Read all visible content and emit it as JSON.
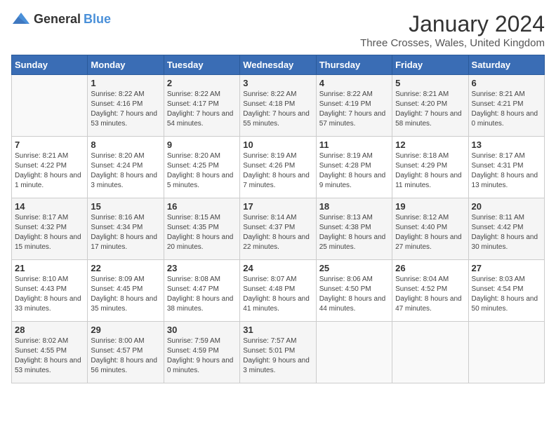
{
  "header": {
    "logo_general": "General",
    "logo_blue": "Blue",
    "title": "January 2024",
    "location": "Three Crosses, Wales, United Kingdom"
  },
  "weekdays": [
    "Sunday",
    "Monday",
    "Tuesday",
    "Wednesday",
    "Thursday",
    "Friday",
    "Saturday"
  ],
  "weeks": [
    [
      {
        "day": "",
        "sunrise": "",
        "sunset": "",
        "daylight": ""
      },
      {
        "day": "1",
        "sunrise": "Sunrise: 8:22 AM",
        "sunset": "Sunset: 4:16 PM",
        "daylight": "Daylight: 7 hours and 53 minutes."
      },
      {
        "day": "2",
        "sunrise": "Sunrise: 8:22 AM",
        "sunset": "Sunset: 4:17 PM",
        "daylight": "Daylight: 7 hours and 54 minutes."
      },
      {
        "day": "3",
        "sunrise": "Sunrise: 8:22 AM",
        "sunset": "Sunset: 4:18 PM",
        "daylight": "Daylight: 7 hours and 55 minutes."
      },
      {
        "day": "4",
        "sunrise": "Sunrise: 8:22 AM",
        "sunset": "Sunset: 4:19 PM",
        "daylight": "Daylight: 7 hours and 57 minutes."
      },
      {
        "day": "5",
        "sunrise": "Sunrise: 8:21 AM",
        "sunset": "Sunset: 4:20 PM",
        "daylight": "Daylight: 7 hours and 58 minutes."
      },
      {
        "day": "6",
        "sunrise": "Sunrise: 8:21 AM",
        "sunset": "Sunset: 4:21 PM",
        "daylight": "Daylight: 8 hours and 0 minutes."
      }
    ],
    [
      {
        "day": "7",
        "sunrise": "Sunrise: 8:21 AM",
        "sunset": "Sunset: 4:22 PM",
        "daylight": "Daylight: 8 hours and 1 minute."
      },
      {
        "day": "8",
        "sunrise": "Sunrise: 8:20 AM",
        "sunset": "Sunset: 4:24 PM",
        "daylight": "Daylight: 8 hours and 3 minutes."
      },
      {
        "day": "9",
        "sunrise": "Sunrise: 8:20 AM",
        "sunset": "Sunset: 4:25 PM",
        "daylight": "Daylight: 8 hours and 5 minutes."
      },
      {
        "day": "10",
        "sunrise": "Sunrise: 8:19 AM",
        "sunset": "Sunset: 4:26 PM",
        "daylight": "Daylight: 8 hours and 7 minutes."
      },
      {
        "day": "11",
        "sunrise": "Sunrise: 8:19 AM",
        "sunset": "Sunset: 4:28 PM",
        "daylight": "Daylight: 8 hours and 9 minutes."
      },
      {
        "day": "12",
        "sunrise": "Sunrise: 8:18 AM",
        "sunset": "Sunset: 4:29 PM",
        "daylight": "Daylight: 8 hours and 11 minutes."
      },
      {
        "day": "13",
        "sunrise": "Sunrise: 8:17 AM",
        "sunset": "Sunset: 4:31 PM",
        "daylight": "Daylight: 8 hours and 13 minutes."
      }
    ],
    [
      {
        "day": "14",
        "sunrise": "Sunrise: 8:17 AM",
        "sunset": "Sunset: 4:32 PM",
        "daylight": "Daylight: 8 hours and 15 minutes."
      },
      {
        "day": "15",
        "sunrise": "Sunrise: 8:16 AM",
        "sunset": "Sunset: 4:34 PM",
        "daylight": "Daylight: 8 hours and 17 minutes."
      },
      {
        "day": "16",
        "sunrise": "Sunrise: 8:15 AM",
        "sunset": "Sunset: 4:35 PM",
        "daylight": "Daylight: 8 hours and 20 minutes."
      },
      {
        "day": "17",
        "sunrise": "Sunrise: 8:14 AM",
        "sunset": "Sunset: 4:37 PM",
        "daylight": "Daylight: 8 hours and 22 minutes."
      },
      {
        "day": "18",
        "sunrise": "Sunrise: 8:13 AM",
        "sunset": "Sunset: 4:38 PM",
        "daylight": "Daylight: 8 hours and 25 minutes."
      },
      {
        "day": "19",
        "sunrise": "Sunrise: 8:12 AM",
        "sunset": "Sunset: 4:40 PM",
        "daylight": "Daylight: 8 hours and 27 minutes."
      },
      {
        "day": "20",
        "sunrise": "Sunrise: 8:11 AM",
        "sunset": "Sunset: 4:42 PM",
        "daylight": "Daylight: 8 hours and 30 minutes."
      }
    ],
    [
      {
        "day": "21",
        "sunrise": "Sunrise: 8:10 AM",
        "sunset": "Sunset: 4:43 PM",
        "daylight": "Daylight: 8 hours and 33 minutes."
      },
      {
        "day": "22",
        "sunrise": "Sunrise: 8:09 AM",
        "sunset": "Sunset: 4:45 PM",
        "daylight": "Daylight: 8 hours and 35 minutes."
      },
      {
        "day": "23",
        "sunrise": "Sunrise: 8:08 AM",
        "sunset": "Sunset: 4:47 PM",
        "daylight": "Daylight: 8 hours and 38 minutes."
      },
      {
        "day": "24",
        "sunrise": "Sunrise: 8:07 AM",
        "sunset": "Sunset: 4:48 PM",
        "daylight": "Daylight: 8 hours and 41 minutes."
      },
      {
        "day": "25",
        "sunrise": "Sunrise: 8:06 AM",
        "sunset": "Sunset: 4:50 PM",
        "daylight": "Daylight: 8 hours and 44 minutes."
      },
      {
        "day": "26",
        "sunrise": "Sunrise: 8:04 AM",
        "sunset": "Sunset: 4:52 PM",
        "daylight": "Daylight: 8 hours and 47 minutes."
      },
      {
        "day": "27",
        "sunrise": "Sunrise: 8:03 AM",
        "sunset": "Sunset: 4:54 PM",
        "daylight": "Daylight: 8 hours and 50 minutes."
      }
    ],
    [
      {
        "day": "28",
        "sunrise": "Sunrise: 8:02 AM",
        "sunset": "Sunset: 4:55 PM",
        "daylight": "Daylight: 8 hours and 53 minutes."
      },
      {
        "day": "29",
        "sunrise": "Sunrise: 8:00 AM",
        "sunset": "Sunset: 4:57 PM",
        "daylight": "Daylight: 8 hours and 56 minutes."
      },
      {
        "day": "30",
        "sunrise": "Sunrise: 7:59 AM",
        "sunset": "Sunset: 4:59 PM",
        "daylight": "Daylight: 9 hours and 0 minutes."
      },
      {
        "day": "31",
        "sunrise": "Sunrise: 7:57 AM",
        "sunset": "Sunset: 5:01 PM",
        "daylight": "Daylight: 9 hours and 3 minutes."
      },
      {
        "day": "",
        "sunrise": "",
        "sunset": "",
        "daylight": ""
      },
      {
        "day": "",
        "sunrise": "",
        "sunset": "",
        "daylight": ""
      },
      {
        "day": "",
        "sunrise": "",
        "sunset": "",
        "daylight": ""
      }
    ]
  ]
}
